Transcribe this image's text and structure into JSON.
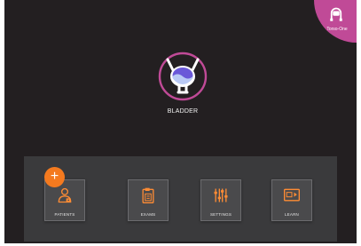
{
  "probe": {
    "label": "Torso-One",
    "icon": "probe-icon"
  },
  "organ": {
    "label": "BLADDER",
    "icon": "bladder-icon"
  },
  "nav": {
    "add_label": "+",
    "items": [
      {
        "label": "PATIENTS",
        "icon": "patient-icon"
      },
      {
        "label": "EXAMS",
        "icon": "exams-icon"
      },
      {
        "label": "SETTINGS",
        "icon": "settings-icon"
      },
      {
        "label": "LEARN",
        "icon": "learn-icon"
      }
    ]
  },
  "colors": {
    "background": "#231f21",
    "panel": "#3a3a3c",
    "accent_pink": "#c04a97",
    "accent_orange": "#f47a1f",
    "tile_icon": "#ff8c34"
  }
}
